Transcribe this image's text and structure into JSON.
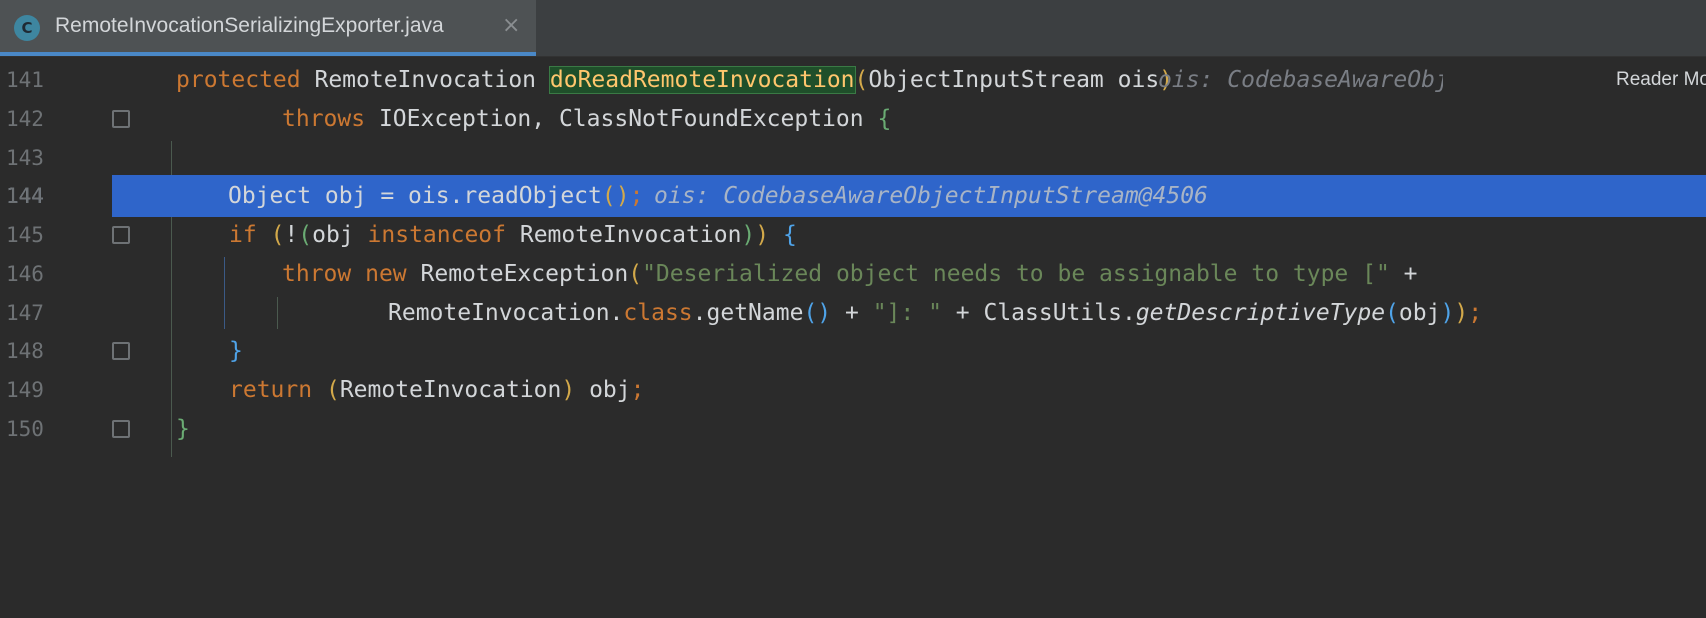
{
  "tab": {
    "icon_letter": "C",
    "title": "RemoteInvocationSerializingExporter.java",
    "close_glyph": "×"
  },
  "reader_mode": "Reader Mode",
  "lines": [
    {
      "num": "141"
    },
    {
      "num": "142"
    },
    {
      "num": "143"
    },
    {
      "num": "144"
    },
    {
      "num": "145"
    },
    {
      "num": "146"
    },
    {
      "num": "147"
    },
    {
      "num": "148"
    },
    {
      "num": "149"
    },
    {
      "num": "150"
    }
  ],
  "code": {
    "l141": {
      "kw": "protected",
      "type": " RemoteInvocation ",
      "method": "doReadRemoteInvocation",
      "open": "(",
      "param": "ObjectInputStream ois",
      "close": ")",
      "hint": "ois: CodebaseAwareObje"
    },
    "l142": {
      "kw": "throws",
      "rest": " IOException, ClassNotFoundException ",
      "brace": "{"
    },
    "l144": {
      "text": "Object obj = ois.readObject",
      "paren": "()",
      "semi": ";",
      "hint": "ois: CodebaseAwareObjectInputStream@4506"
    },
    "l145": {
      "kw": "if",
      "sp": " ",
      "p1": "(",
      "not": "!",
      "p2": "(",
      "obj": "obj ",
      "kw2": "instanceof",
      "type": " RemoteInvocation",
      "p2c": ")",
      "p1c": ")",
      "sp2": " ",
      "brace": "{"
    },
    "l146": {
      "kw": "throw",
      "sp": " ",
      "kw2": "new",
      "cls": " RemoteException",
      "paren": "(",
      "str": "\"Deserialized object needs to be assignable to type [\"",
      "plus": " +"
    },
    "l147": {
      "a": "RemoteInvocation.",
      "kw": "class",
      "b": ".getName",
      "p": "()",
      "c": " + ",
      "str": "\"]: \"",
      "d": " + ClassUtils.",
      "fn": "getDescriptiveType",
      "po": "(",
      "arg": "obj",
      "pc": ")",
      "pc2": ")",
      "semi": ";"
    },
    "l148": {
      "brace": "}"
    },
    "l149": {
      "kw": "return",
      "sp": " ",
      "po": "(",
      "type": "RemoteInvocation",
      "pc": ")",
      "rest": " obj",
      "semi": ";"
    },
    "l150": {
      "brace": "}"
    }
  }
}
